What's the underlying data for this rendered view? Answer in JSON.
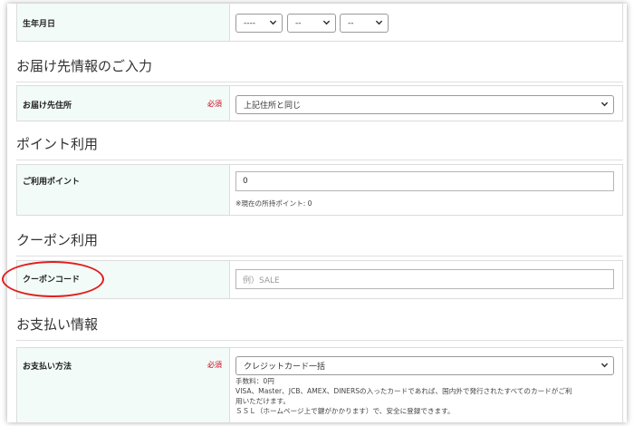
{
  "birth": {
    "label": "生年月日",
    "year": "----",
    "month": "--",
    "day": "--"
  },
  "delivery": {
    "section_title": "お届け先情報のご入力",
    "label": "お届け先住所",
    "required": "必須",
    "selected": "上記住所と同じ"
  },
  "points": {
    "section_title": "ポイント利用",
    "label": "ご利用ポイント",
    "value": "0",
    "note": "※現在の所持ポイント: 0"
  },
  "coupon": {
    "section_title": "クーポン利用",
    "label": "クーポンコード",
    "placeholder": "例）SALE"
  },
  "payment": {
    "section_title": "お支払い情報",
    "label": "お支払い方法",
    "required": "必須",
    "selected": "クレジットカード一括",
    "fee": "手数料：0円",
    "desc1": "VISA、Master、JCB、AMEX、DINERSの入ったカードであれば、国内外で発行されたすべてのカードがご利",
    "desc2": "用いただけます。",
    "desc3": "ＳＳＬ（ホームページ上で鍵がかかります）で、安全に登録できます。"
  },
  "colors": {
    "label_bg": "#f2fbf7",
    "required": "#d0021b",
    "annotation": "#e21d1d"
  }
}
